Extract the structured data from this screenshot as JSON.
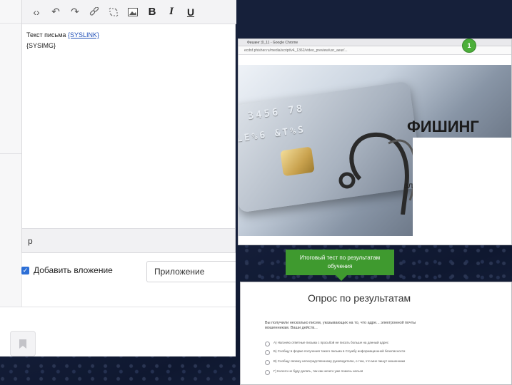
{
  "editor": {
    "toolbar": {
      "source_icon": "‹›",
      "undo_icon": "↶",
      "redo_icon": "↷",
      "link_icon": "🔗",
      "unlink_icon": "⛓",
      "image_icon": "▣",
      "bold_label": "B",
      "italic_label": "I",
      "underline_label": "U"
    },
    "body": {
      "text_prefix": "Текст письма",
      "link_token": "{SYSLINK}",
      "image_token": "{SYSIMG}"
    },
    "status_path": "p"
  },
  "attachment": {
    "checkbox_label": "Добавить вложение",
    "checked": true,
    "select_value": "Приложение"
  },
  "player": {
    "window_title": "Фишинг ¦0_11 - Google Chrome",
    "url": "ecdnf.phisher.ru/media/script/v4_1362/video_preview/usr_aeur/...",
    "headline": "ФИШИНГ",
    "partial_text": "зл",
    "card_number_1": "3456 78",
    "card_number_2": "LE%6 &T%S",
    "progress": 0.02
  },
  "badge_number": "1",
  "tooltip_text": "Итоговый тест по результатам обучения",
  "survey": {
    "title": "Опрос по результатам",
    "question": "Вы получили несколько писем, указывающих на то, что адре... электронной почты стал навестен мошенникам. Ваши действ...",
    "options": [
      "А) Нагоняю ответные письма с просьбой не писать больше на данный адрес",
      "Б) Сообщу в форме получения такого письма в Службу информационной безопасности",
      "В) Сообщу своему непосредственному руководителю, о том, что мне пишут мошенники",
      "Г) Ничего не буду делать, так как ничего уже помочь нельзя"
    ]
  },
  "colors": {
    "accent_blue": "#2d6fd6",
    "link_blue": "#1f4fb8",
    "green": "#3f9a2f",
    "backdrop": "#16203a"
  }
}
